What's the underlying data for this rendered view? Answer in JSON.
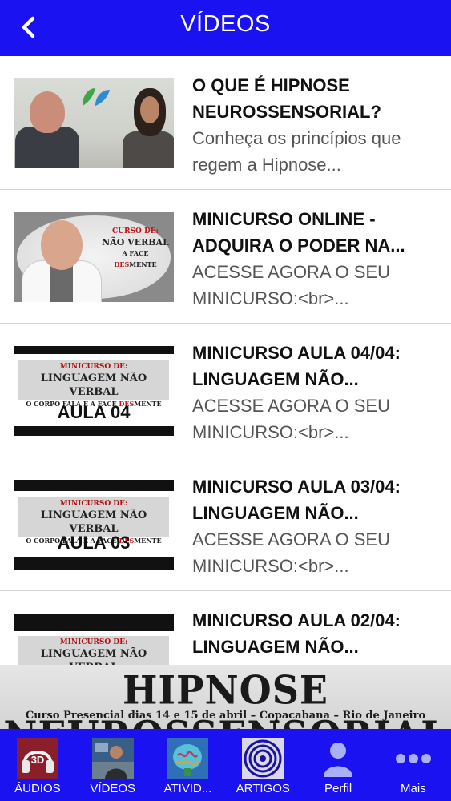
{
  "header": {
    "title": "VÍDEOS",
    "back_icon": "chevron-left-icon"
  },
  "videos": [
    {
      "title": "O QUE É HIPNOSE NEUROSSENSORIAL?",
      "description": "Conheça os princípios que regem a Hipnose..."
    },
    {
      "title": "MINICURSO ONLINE - ADQUIRA O PODER NA...",
      "description": "ACESSE AGORA O SEU MINICURSO:<br>...",
      "thumb_text": [
        "CURSO DE:",
        "NÃO VERBAL",
        "A FACE",
        "DES",
        "MENTE"
      ]
    },
    {
      "title": "MINICURSO AULA 04/04: LINGUAGEM NÃO...",
      "description": "ACESSE AGORA O SEU MINICURSO:<br>...",
      "thumb": {
        "line1": "MINICURSO DE:",
        "line2": "LINGUAGEM NÃO VERBAL",
        "line3a": "O CORPO FALA E A FACE ",
        "line3b": "DES",
        "line3c": "MENTE",
        "aula": "AULA 04"
      }
    },
    {
      "title": "MINICURSO AULA 03/04: LINGUAGEM NÃO...",
      "description": "ACESSE AGORA O SEU MINICURSO:<br>...",
      "thumb": {
        "line1": "MINICURSO DE:",
        "line2": "LINGUAGEM NÃO VERBAL",
        "line3a": "O CORPO FALA E A FACE ",
        "line3b": "DES",
        "line3c": "MENTE",
        "aula": "AULA 03"
      }
    },
    {
      "title": "MINICURSO AULA 02/04: LINGUAGEM NÃO...",
      "description": "",
      "thumb": {
        "line1": "MINICURSO DE:",
        "line2": "LINGUAGEM NÃO VERBAL"
      }
    }
  ],
  "banner": {
    "title": "HIPNOSE NEUROSSENSORIAL",
    "subtitle": "Curso Presencial dias 14 e 15 de abril – Copacabana – Rio de Janeiro"
  },
  "tabs": [
    {
      "label": "ÁUDIOS",
      "icon": "headphones-3d-icon"
    },
    {
      "label": "VÍDEOS",
      "icon": "video-person-icon"
    },
    {
      "label": "ATIVID...",
      "icon": "brain-icon"
    },
    {
      "label": "ARTIGOS",
      "icon": "target-icon"
    },
    {
      "label": "Perfil",
      "icon": "person-icon"
    },
    {
      "label": "Mais",
      "icon": "more-dots-icon"
    }
  ],
  "colors": {
    "primary": "#1a12f0",
    "accent_red": "#c41414"
  }
}
